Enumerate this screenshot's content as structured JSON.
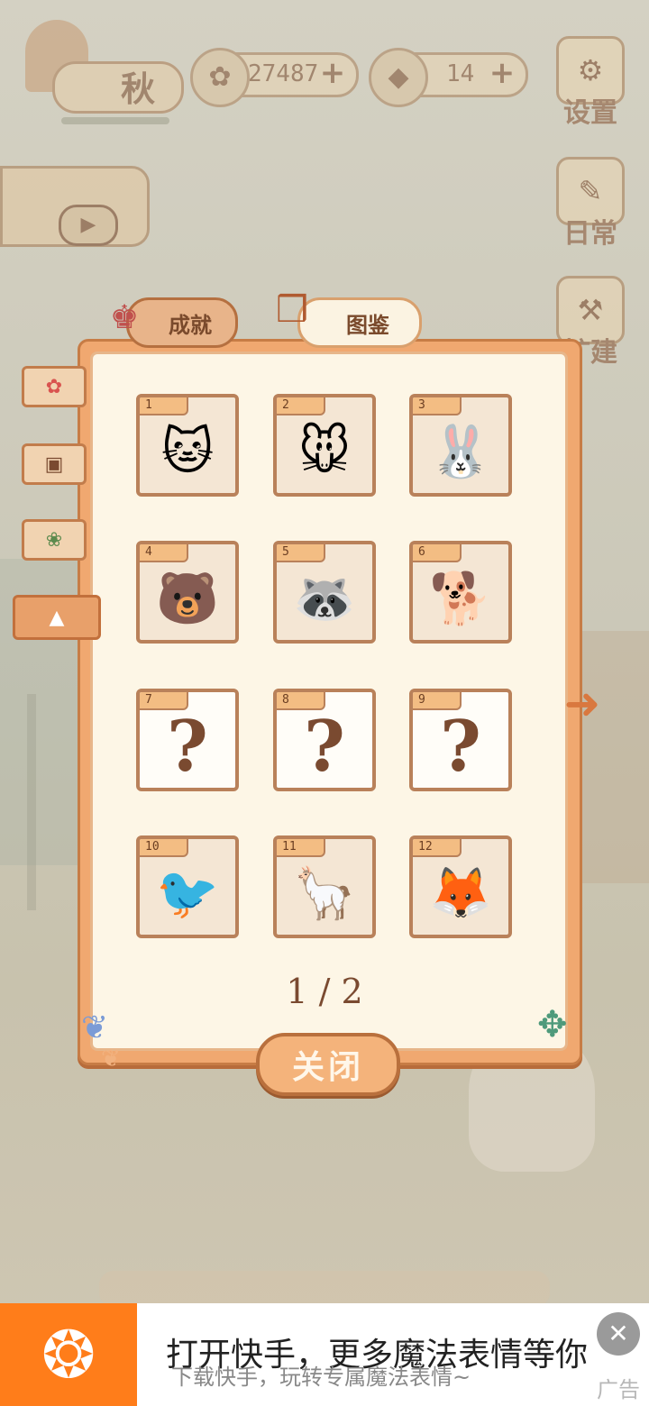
{
  "hud": {
    "season": "秋",
    "fish_coins": "27487",
    "cheese": "14",
    "plus": "+",
    "settings": "设置",
    "daily": "日常",
    "build": "扩建"
  },
  "tabs": {
    "achievements": "成就",
    "catalog": "图鉴"
  },
  "cards": [
    {
      "num": "1",
      "icon": "cat-icon",
      "glyph": "🐱",
      "unlocked": true
    },
    {
      "num": "2",
      "icon": "mouse-icon",
      "glyph": "🐭",
      "unlocked": true
    },
    {
      "num": "3",
      "icon": "rabbit-icon",
      "glyph": "🐰",
      "unlocked": true
    },
    {
      "num": "4",
      "icon": "bear-icon",
      "glyph": "🐻",
      "unlocked": true
    },
    {
      "num": "5",
      "icon": "raccoon-icon",
      "glyph": "🦝",
      "unlocked": true
    },
    {
      "num": "6",
      "icon": "shiba-icon",
      "glyph": "🐕",
      "unlocked": true
    },
    {
      "num": "7",
      "icon": "question-icon",
      "glyph": "?",
      "unlocked": false
    },
    {
      "num": "8",
      "icon": "question-icon",
      "glyph": "?",
      "unlocked": false
    },
    {
      "num": "9",
      "icon": "question-icon",
      "glyph": "?",
      "unlocked": false
    },
    {
      "num": "10",
      "icon": "crow-icon",
      "glyph": "🐦",
      "unlocked": true
    },
    {
      "num": "11",
      "icon": "alpaca-icon",
      "glyph": "🦙",
      "unlocked": true
    },
    {
      "num": "12",
      "icon": "fox-icon",
      "glyph": "🦊",
      "unlocked": true
    }
  ],
  "page_indicator": "1 / 2",
  "close_button": "关闭",
  "ad": {
    "title": "打开快手，更多魔法表情等你",
    "subtitle": "下载快手，玩转专属魔法表情~",
    "label": "广告",
    "close": "✕"
  },
  "colors": {
    "panel": "#f0a870",
    "panel_inner": "#fdf6e6",
    "card_border": "#b9815a",
    "close_button": "#f4b37b",
    "ad_brand": "#ff7d1a"
  }
}
